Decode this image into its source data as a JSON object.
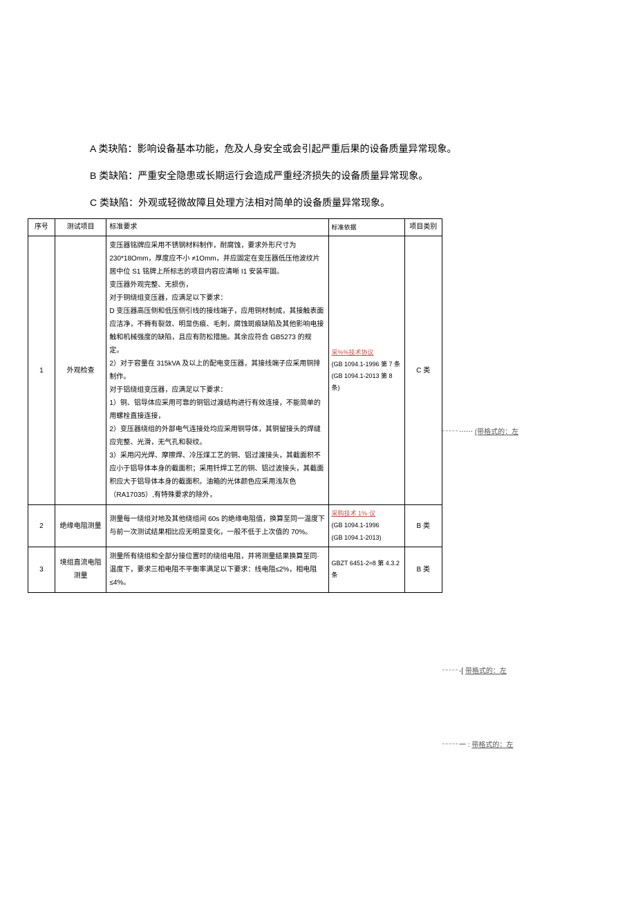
{
  "intro": {
    "a": "A 类玦陷：影响设备基本功能，危及人身安全或会引起严重后果的设备质量异常现象。",
    "b": "B 类缺陷：严重安全隐患或长期运行会造成严重经济损失的设备质量异常现象。",
    "c": "C 类缺陷：外观或轻微故障且处理方法相对简单的设备质量异常现象。"
  },
  "headers": {
    "seq": "序号",
    "item": "测试项目",
    "req": "标准要求",
    "basis": "标准依据",
    "cat": "项目类别"
  },
  "rows": [
    {
      "seq": "1",
      "item": "外观检查",
      "req": "变压器铭牌应采用不锈钢材料制作，耐腐蚀，要求外形尺寸为 230*18Omm，厚度应不小 ≠1Omm，并应固定在变压器低压他波纹片居中位 S1 铭牌上所标志的项目内容应清晰 I1 安装牢固。\n变压器外观完整、无损伤，\n对于铜绕组变压器，应满足以下要求：\nD 变压器高压侧和低压侧引线的接线端子，应用铜材制成，其接触表面应洁净，不褥有裂敛、明显伤痕、毛刺，腐蚀斑痕缺陷及其他影响电接触和机械强度的缺陷，且应有防松措施。其余应符合 GB5273 的规定。\n2）对于容量在 315kVA 及以上的配电变压器，其接线端子应采用铜排制作。\n对于铝绕组变压器，应满足以下要求：\n1）铜、铝导体应采用可靠的铜铝过渡结构进行有效连接，不能简单的用螺栓直接连接，\n2）变压器绕组的外部电气连接处均应采用铜导体，其铜留接头的焊缝应完整、光滑，无气孔和裂纹。\n3）采用闪光焊、摩擦焊、冷压煤工艺的铜、铝过渡接头，其截面积不应小于铝导体本身的截面积；采用钎焊工艺的铜、铝过波接头，其截面积应大于铝导体本身的截面积。油箱的光体颜色应采用浅灰色（RA17035）,有特殊要求的除外，",
      "basis_link": "采%%技术协议",
      "basis_rest": "(GB 1094.1-1996 第 7 条\n(GB 1094.1-2013 第 8 条)",
      "cat": "C 类"
    },
    {
      "seq": "2",
      "item": "绝缘电阻测量",
      "req": "测量每一绕组对地及其他绕组间 60s 的绝缘电阻值，换算至同一温度下与前一次测试结果相比应无明显变化，一般不低于上次值的 70%。",
      "basis_link": "采购技术 1%·议",
      "basis_rest": "(GB 1094.1-1996\n(GB 1094.1-2013)",
      "cat": "B 类"
    },
    {
      "seq": "3",
      "item": "境组直流电阻测量",
      "req": "测量所有绕组和全部分接位置时的绕组电阻，并将测量结果换算至同·温度下，要求三相电阻不平衡率满足以下要求：线电阻≤2%，相电阻≤4%。",
      "basis_link": "",
      "basis_rest": "GBZT 6451-2≈8 第 4.3.2 条",
      "cat": "B 类"
    }
  ],
  "comments": {
    "c1": {
      "prefix": "⋯⋯",
      "text": "(带格式的：左"
    },
    "c2": {
      "prefix": "-[",
      "text": "带格式的：左"
    },
    "c3": {
      "prefix": "一 :",
      "text": "带格式的：左"
    }
  }
}
